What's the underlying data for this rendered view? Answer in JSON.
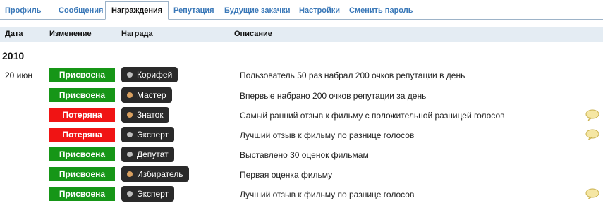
{
  "tabs": [
    {
      "label": "Профиль",
      "active": false
    },
    {
      "label": "Сообщения",
      "active": false
    },
    {
      "label": "Награждения",
      "active": true
    },
    {
      "label": "Репутация",
      "active": false
    },
    {
      "label": "Будущие закачки",
      "active": false
    },
    {
      "label": "Настройки",
      "active": false
    },
    {
      "label": "Сменить пароль",
      "active": false
    }
  ],
  "columns": {
    "date": "Дата",
    "change": "Изменение",
    "award": "Награда",
    "description": "Описание"
  },
  "year": "2010",
  "rows": [
    {
      "date": "20 июн",
      "status": "Присвоена",
      "status_color": "#169617",
      "award": "Корифей",
      "dot_color": "#bdbdbd",
      "description": "Пользователь 50 раз набрал 200 очков репутации в день",
      "comment_icon": false
    },
    {
      "date": "",
      "status": "Присвоена",
      "status_color": "#169617",
      "award": "Мастер",
      "dot_color": "#d9a060",
      "description": "Впервые набрано 200 очков репутации за день",
      "comment_icon": false
    },
    {
      "date": "",
      "status": "Потеряна",
      "status_color": "#f01414",
      "award": "Знаток",
      "dot_color": "#d9a060",
      "description": "Самый ранний отзыв к фильму с положительной разницей голосов",
      "comment_icon": true
    },
    {
      "date": "",
      "status": "Потеряна",
      "status_color": "#f01414",
      "award": "Эксперт",
      "dot_color": "#bdbdbd",
      "description": "Лучший отзыв к фильму по разнице голосов",
      "comment_icon": true
    },
    {
      "date": "",
      "status": "Присвоена",
      "status_color": "#169617",
      "award": "Депутат",
      "dot_color": "#bdbdbd",
      "description": "Выставлено 30 оценок фильмам",
      "comment_icon": false
    },
    {
      "date": "",
      "status": "Присвоена",
      "status_color": "#169617",
      "award": "Избиратель",
      "dot_color": "#d9a060",
      "description": "Первая оценка фильму",
      "comment_icon": false
    },
    {
      "date": "",
      "status": "Присвоена",
      "status_color": "#169617",
      "award": "Эксперт",
      "dot_color": "#bdbdbd",
      "description": "Лучший отзыв к фильму по разнице голосов",
      "comment_icon": true
    }
  ],
  "icons": {
    "comment": "speech-bubble-icon"
  }
}
